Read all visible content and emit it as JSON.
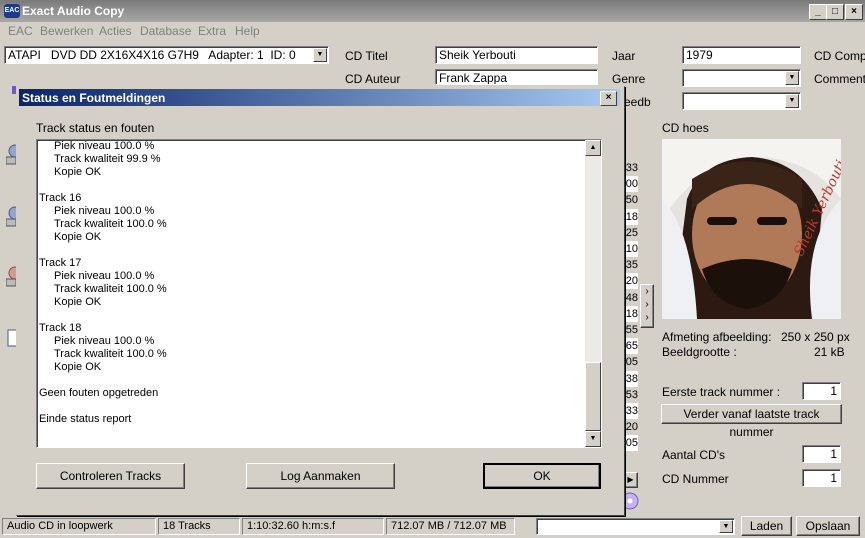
{
  "window": {
    "title": "Exact Audio Copy"
  },
  "title_buttons": {
    "minimize": "_",
    "maximize": "□",
    "close": "×"
  },
  "menu": [
    "EAC",
    "Bewerken",
    "Acties",
    "Database",
    "Extra",
    "Help"
  ],
  "drive": {
    "selected": "ATAPI   DVD DD 2X16X4X16 G7H9   Adapter: 1  ID: 0"
  },
  "cd_info": {
    "title_label": "CD Titel",
    "title_value": "Sheik Yerbouti",
    "artist_label": "CD Auteur",
    "artist_value": "Frank Zappa",
    "year_label": "Jaar",
    "year_value": "1979",
    "genre_label": "Genre",
    "genre_value": "",
    "freedb_label": "eedb",
    "freedb_value": "",
    "composer_label": "CD Compo",
    "comment_label": "Commenta"
  },
  "cover": {
    "heading": "CD hoes",
    "signature": "Sheik Yerbouti",
    "size_label": "Afmeting afbeelding:",
    "size_value": "250 x 250 px",
    "filesize_label": "Beeldgrootte :",
    "filesize_value": "21 kB"
  },
  "track_options": {
    "first_track_label": "Eerste track nummer :",
    "first_track_value": "1",
    "continue_button": "Verder vanaf laatste track nummer",
    "num_cds_label": "Aantal CD's",
    "num_cds_value": "1",
    "cd_number_label": "CD Nummer",
    "cd_number_value": "1"
  },
  "track_column_fragments": [
    "33",
    "00",
    "50",
    "18",
    "25",
    "10",
    "35",
    "20",
    "48",
    "18",
    "55",
    "65",
    "05",
    "38",
    "53",
    "33",
    "20",
    "05"
  ],
  "dialog": {
    "title": "Status en Foutmeldingen",
    "close": "×",
    "section_label": "Track status en fouten",
    "log": [
      {
        "text": "Piek niveau 100.0 %",
        "indent": true
      },
      {
        "text": "Track kwaliteit 99.9 %",
        "indent": true
      },
      {
        "text": "Kopie OK",
        "indent": true
      },
      {
        "text": "",
        "indent": false
      },
      {
        "text": "Track 16",
        "indent": false
      },
      {
        "text": "Piek niveau 100.0 %",
        "indent": true
      },
      {
        "text": "Track kwaliteit 100.0 %",
        "indent": true
      },
      {
        "text": "Kopie OK",
        "indent": true
      },
      {
        "text": "",
        "indent": false
      },
      {
        "text": "Track 17",
        "indent": false
      },
      {
        "text": "Piek niveau 100.0 %",
        "indent": true
      },
      {
        "text": "Track kwaliteit 100.0 %",
        "indent": true
      },
      {
        "text": "Kopie OK",
        "indent": true
      },
      {
        "text": "",
        "indent": false
      },
      {
        "text": "Track 18",
        "indent": false
      },
      {
        "text": "Piek niveau 100.0 %",
        "indent": true
      },
      {
        "text": "Track kwaliteit 100.0 %",
        "indent": true
      },
      {
        "text": "Kopie OK",
        "indent": true
      },
      {
        "text": "",
        "indent": false
      },
      {
        "text": "Geen fouten opgetreden",
        "indent": false
      },
      {
        "text": "",
        "indent": false
      },
      {
        "text": "Einde status report",
        "indent": false
      }
    ],
    "buttons": {
      "check": "Controleren Tracks",
      "log": "Log Aanmaken",
      "ok": "OK"
    }
  },
  "statusbar": {
    "drive_status": "Audio CD in loopwerk",
    "tracks": "18 Tracks",
    "duration": "1:10:32.60 h:m:s.f",
    "size": "712.07 MB / 712.07 MB",
    "profile": ""
  },
  "bottom_buttons": {
    "load": "Laden",
    "save": "Opslaan"
  },
  "colors": {
    "dialog_title_start": "#0a246a",
    "dialog_title_end": "#a6caf0",
    "window_bg": "#d4d0c8"
  }
}
